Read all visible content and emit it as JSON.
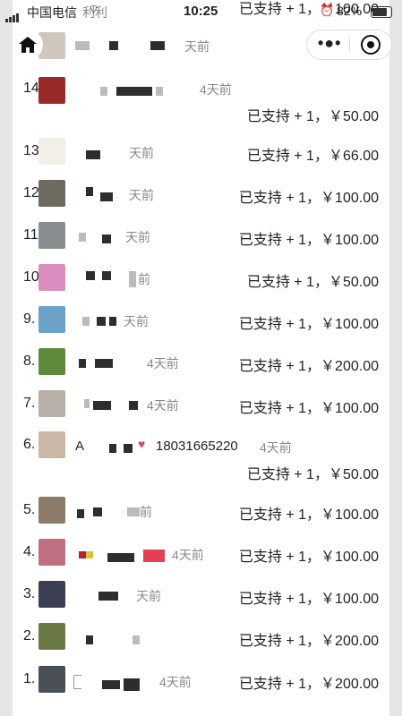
{
  "status_bar": {
    "carrier": "中国电信",
    "extra": "利利",
    "time": "10:25",
    "battery": "82%"
  },
  "list": [
    {
      "rank": "15.",
      "time_ago": "天前",
      "support": "已支持 + 1，￥50.00"
    },
    {
      "rank": "14.",
      "time_ago": "4天前",
      "support": "已支持 + 1，￥50.00"
    },
    {
      "rank": "13.",
      "time_ago": "天前",
      "support": "已支持 + 1，￥66.00"
    },
    {
      "rank": "12.",
      "time_ago": "天前",
      "support": "已支持 + 1，￥100.00"
    },
    {
      "rank": "11.",
      "time_ago": "天前",
      "support": "已支持 + 1，￥100.00"
    },
    {
      "rank": "10.",
      "time_ago": "前",
      "support": "已支持 + 1，￥50.00"
    },
    {
      "rank": "9.",
      "time_ago": "天前",
      "support": "已支持 + 1，￥100.00"
    },
    {
      "rank": "8.",
      "time_ago": "4天前",
      "support": "已支持 + 1，￥200.00"
    },
    {
      "rank": "7.",
      "time_ago": "4天前",
      "support": "已支持 + 1，￥100.00"
    },
    {
      "rank": "6.",
      "name_prefix": "A",
      "phone": "18031665220",
      "time_ago": "4天前",
      "support": "已支持 + 1，￥50.00"
    },
    {
      "rank": "5.",
      "time_ago": "前",
      "support": "已支持 + 1，￥100.00"
    },
    {
      "rank": "4.",
      "time_ago": "4天前",
      "support": "已支持 + 1，￥100.00"
    },
    {
      "rank": "3.",
      "time_ago": "天前",
      "support": "已支持 + 1，￥100.00"
    },
    {
      "rank": "2.",
      "time_ago": "",
      "support": "已支持 + 1，￥200.00"
    },
    {
      "rank": "1.",
      "time_ago": "4天前",
      "support": "已支持 + 1，￥200.00"
    }
  ],
  "top_partial": {
    "support": "已支持 + 1，￥100.00"
  },
  "colors": {
    "background": "#e6e6e6",
    "card": "#ffffff",
    "meta": "#888888"
  },
  "icons": {
    "home": "home-icon",
    "more": "more-icon",
    "close": "target-icon",
    "heart": "heart-icon",
    "signal": "signal-icon",
    "wifi": "wifi-icon"
  }
}
